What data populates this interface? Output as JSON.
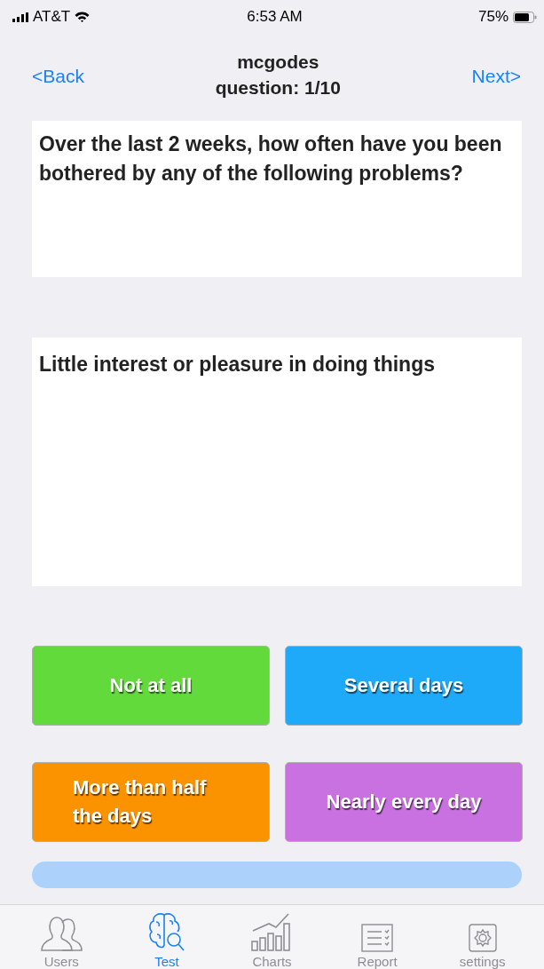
{
  "status_bar": {
    "carrier": "AT&T",
    "time": "6:53 AM",
    "battery": "75%"
  },
  "nav": {
    "back": "<Back",
    "title": "mcgodes",
    "subtitle": "question: 1/10",
    "next": "Next>"
  },
  "prompt": "Over the last 2 weeks, how often have you been bothered by any of the following problems?",
  "item": "Little interest or pleasure in doing things",
  "answers": [
    {
      "label": "Not at all",
      "color": "#63da3c"
    },
    {
      "label": "Several days",
      "color": "#1eaaf8"
    },
    {
      "label": "More than half the days",
      "color": "#fb9300"
    },
    {
      "label": "Nearly every day",
      "color": "#c971e0"
    }
  ],
  "tabs": [
    {
      "label": "Users",
      "kind": "users",
      "selected": false
    },
    {
      "label": "Test",
      "kind": "test",
      "selected": true
    },
    {
      "label": "Charts",
      "kind": "charts",
      "selected": false
    },
    {
      "label": "Report",
      "kind": "report",
      "selected": false
    },
    {
      "label": "settings",
      "kind": "settings",
      "selected": false
    }
  ]
}
